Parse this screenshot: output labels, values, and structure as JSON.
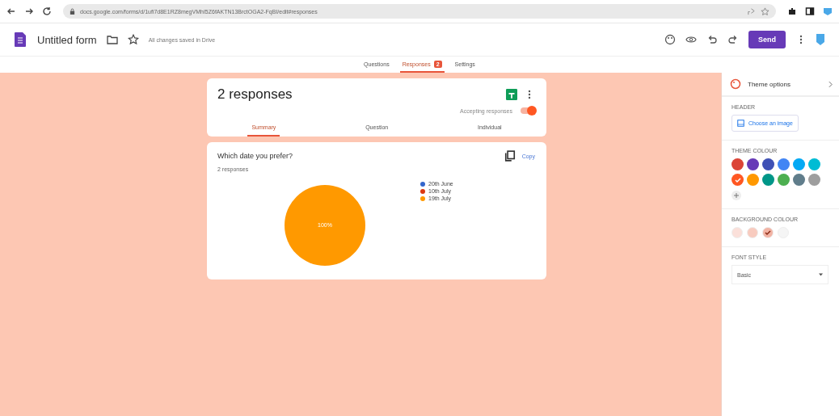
{
  "browser": {
    "url": "docs.google.com/forms/d/1ufi7d8E1RZ8megVMhI5Z6fAKTN13BrctOGA2-FqBI/edit#responses"
  },
  "header": {
    "title": "Untitled form",
    "save_status": "All changes saved in Drive",
    "send_button": "Send"
  },
  "tabs": [
    {
      "label": "Questions",
      "selected": false
    },
    {
      "label": "Responses",
      "selected": true,
      "badge": "2"
    },
    {
      "label": "Settings",
      "selected": false
    }
  ],
  "summary_card": {
    "title": "2 responses",
    "accepting_label": "Accepting responses",
    "accepting": true,
    "subtabs": [
      {
        "label": "Summary",
        "selected": true
      },
      {
        "label": "Question",
        "selected": false
      },
      {
        "label": "Individual",
        "selected": false
      }
    ]
  },
  "question_card": {
    "title": "Which date you prefer?",
    "count": "2 responses",
    "copy_button": "Copy",
    "chart_data": {
      "type": "pie",
      "categories": [
        "20th June",
        "10th July",
        "19th July"
      ],
      "values": [
        0,
        0,
        100
      ],
      "colors": [
        "#3366cc",
        "#dc3912",
        "#ff9900"
      ],
      "data_labels": true,
      "value_labels": [
        null,
        null,
        "100%"
      ]
    }
  },
  "theme_panel": {
    "title": "Theme options",
    "header_label": "HEADER",
    "choose_image": "Choose an image",
    "theme_colour_label": "THEME COLOUR",
    "theme_colours": [
      {
        "color": "#db4437",
        "selected": false
      },
      {
        "color": "#673ab7",
        "selected": false
      },
      {
        "color": "#3f51b5",
        "selected": false
      },
      {
        "color": "#4285f4",
        "selected": false
      },
      {
        "color": "#03a9f4",
        "selected": false
      },
      {
        "color": "#00bcd4",
        "selected": false
      },
      {
        "color": "#ff5722",
        "selected": true
      },
      {
        "color": "#ff9800",
        "selected": false
      },
      {
        "color": "#009688",
        "selected": false
      },
      {
        "color": "#4caf50",
        "selected": false
      },
      {
        "color": "#607d8b",
        "selected": false
      },
      {
        "color": "#9e9e9e",
        "selected": false
      }
    ],
    "background_colour_label": "BACKGROUND COLOUR",
    "background_colours": [
      {
        "color": "#fbe0da",
        "selected": false
      },
      {
        "color": "#f8cbbf",
        "selected": false
      },
      {
        "color": "#f2b3a4",
        "selected": true
      },
      {
        "color": "#f5f5f5",
        "selected": false
      }
    ],
    "font_style_label": "FONT STYLE",
    "font_style": "Basic"
  }
}
